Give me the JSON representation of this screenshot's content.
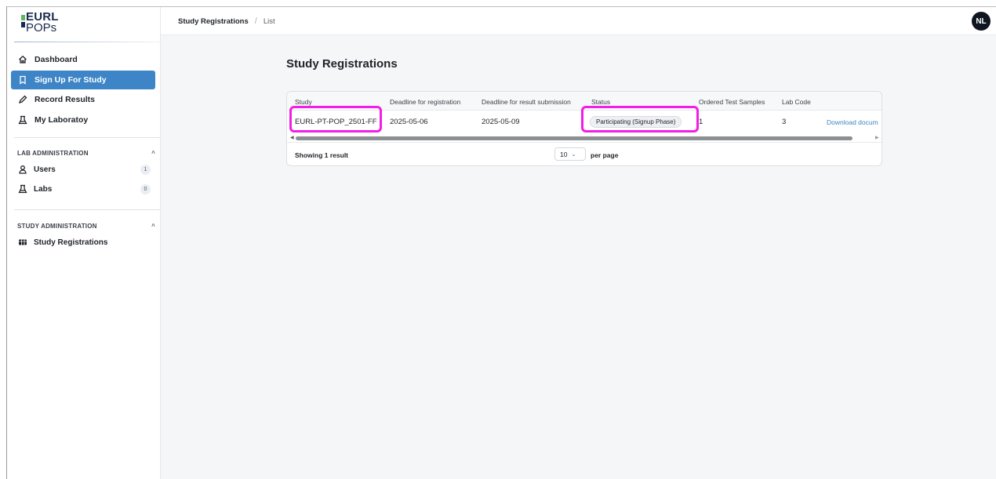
{
  "brand": {
    "line1": "EURL",
    "line2": "POPs",
    "mark_colors": [
      "#5cb85c",
      "#1a2a4f"
    ]
  },
  "sidebar": {
    "items": [
      {
        "label": "Dashboard",
        "icon": "home-icon",
        "active": false
      },
      {
        "label": "Sign Up For Study",
        "icon": "bookmark-icon",
        "active": true
      },
      {
        "label": "Record Results",
        "icon": "pencil-icon",
        "active": false
      },
      {
        "label": "My Laboratoy",
        "icon": "flask-icon",
        "active": false
      }
    ],
    "lab_admin": {
      "title": "LAB ADMINISTRATION",
      "items": [
        {
          "label": "Users",
          "icon": "user-icon",
          "count": "1"
        },
        {
          "label": "Labs",
          "icon": "flask-icon",
          "count": "0"
        }
      ]
    },
    "study_admin": {
      "title": "STUDY ADMINISTRATION",
      "items": [
        {
          "label": "Study Registrations",
          "icon": "table-icon"
        }
      ]
    }
  },
  "header": {
    "breadcrumb": [
      "Study Registrations",
      "List"
    ],
    "avatar_initials": "NL"
  },
  "main": {
    "title": "Study Registrations",
    "table": {
      "columns": [
        "Study",
        "Deadline for registration",
        "Deadline for result submission",
        "Status",
        "Ordered Test Samples",
        "Lab Code"
      ],
      "rows": [
        {
          "study": "EURL-PT-POP_2501-FF",
          "deadline_registration": "2025-05-06",
          "deadline_results": "2025-05-09",
          "status": "Participating (Signup Phase)",
          "ordered_test_samples": "1",
          "lab_code": "3",
          "action": "Download docum"
        }
      ]
    },
    "footer": {
      "showing": "Showing 1 result",
      "per_page_value": "10",
      "per_page_label": "per page"
    }
  },
  "colors": {
    "accent": "#3d85c6",
    "highlight": "#f21ee8",
    "background": "#f5f6f8"
  }
}
